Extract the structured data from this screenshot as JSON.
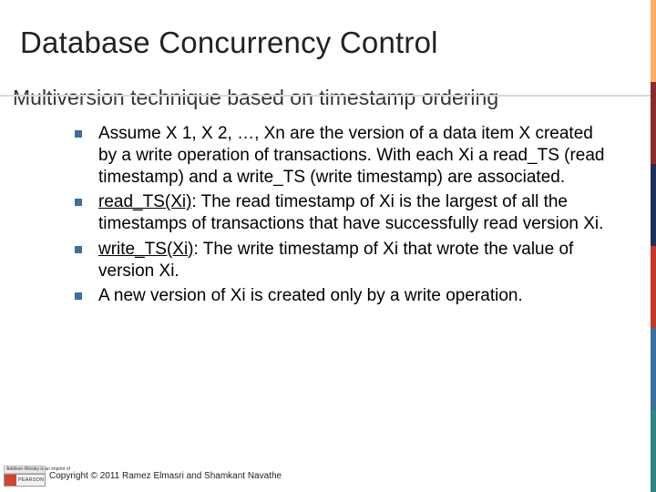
{
  "title": "Database Concurrency Control",
  "subhead": "Multiversion technique based on timestamp ordering",
  "bullets": [
    {
      "html": "Assume X 1, X 2, …, Xn are the version of a data item X created by a write operation of transactions.  With each Xi a read_TS (read timestamp) and a write_TS (write timestamp) are associated."
    },
    {
      "html": "<span class='u'>read_TS(Xi)</span>:  The read timestamp of Xi is the largest of all the timestamps of transactions that have successfully read version Xi."
    },
    {
      "html": "<span class='u'>write_TS(Xi)</span>:  The write timestamp of Xi that wrote the value of version Xi."
    },
    {
      "html": "A new version of Xi is created only by a write operation."
    }
  ],
  "logo": {
    "top": "Addison-Wesley is an imprint of",
    "brand": "PEARSON"
  },
  "copyright": "Copyright © 2011 Ramez Elmasri and Shamkant Navathe"
}
